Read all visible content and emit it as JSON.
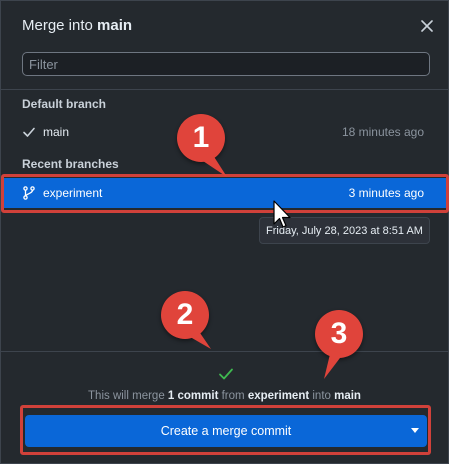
{
  "dialog": {
    "title_prefix": "Merge into ",
    "title_branch": "main",
    "close_label": "×"
  },
  "filter": {
    "placeholder": "Filter",
    "value": ""
  },
  "default_branch": {
    "section_label": "Default branch",
    "name": "main",
    "time": "18 minutes ago",
    "icon": "check-icon"
  },
  "recent_branches": {
    "section_label": "Recent branches",
    "items": [
      {
        "name": "experiment",
        "time": "3 minutes ago",
        "icon": "git-branch-icon",
        "selected": true
      }
    ]
  },
  "tooltip": {
    "text": "Friday, July 28, 2023 at 8:51 AM"
  },
  "merge_summary": {
    "prefix": "This will merge ",
    "count": "1 commit",
    "middle": " from ",
    "source": "experiment",
    "joiner": " into ",
    "target": "main"
  },
  "merge_button": {
    "label": "Create a merge commit"
  },
  "annotations": [
    {
      "number": "1"
    },
    {
      "number": "2"
    },
    {
      "number": "3"
    }
  ],
  "colors": {
    "accent": "#0a67d8",
    "annotation": "#e0443b",
    "success": "#3fb950"
  }
}
